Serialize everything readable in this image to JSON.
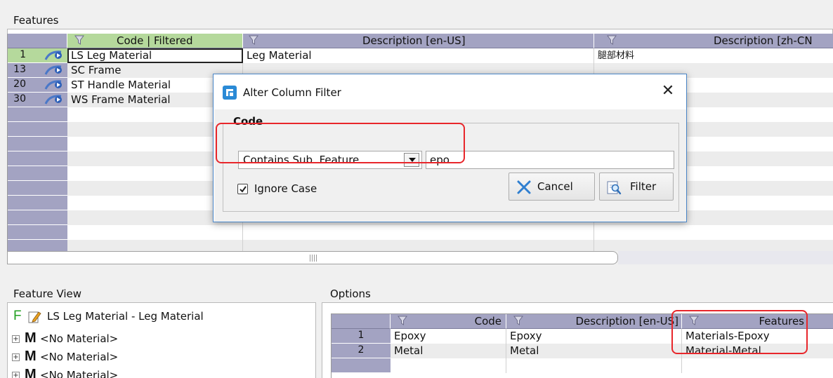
{
  "features_panel": {
    "title": "Features",
    "columns": [
      {
        "label": "Code | Filtered"
      },
      {
        "label": "Description [en-US]"
      },
      {
        "label": "Description [zh-CN"
      }
    ],
    "rows": [
      {
        "num": "1",
        "code": "LS Leg Material",
        "desc": "Leg Material",
        "zh": "腿部材料"
      },
      {
        "num": "13",
        "code": "SC Frame",
        "desc": "",
        "zh": ""
      },
      {
        "num": "20",
        "code": "ST Handle Material",
        "desc": "",
        "zh": ""
      },
      {
        "num": "30",
        "code": "WS Frame Material",
        "desc": "",
        "zh": ""
      }
    ]
  },
  "dialog": {
    "title": "Alter Column Filter",
    "close_glyph": "✕",
    "group_label": "Code",
    "operator": "Contains Sub. Feature",
    "filter_value": "epo",
    "ignore_case_label": "Ignore Case",
    "ignore_case_checked": true,
    "cancel_label": "Cancel",
    "filter_label": "Filter",
    "icons": {
      "app": "app-logo-icon",
      "cancel": "x-cross-icon",
      "filter": "magnifier-filter-icon"
    }
  },
  "feature_view": {
    "title": "Feature View",
    "root": {
      "glyph": "F",
      "label": "LS Leg Material - Leg Material"
    },
    "children": [
      {
        "glyph": "M",
        "label": "<No Material>"
      },
      {
        "glyph": "M",
        "label": "<No Material>"
      },
      {
        "glyph": "M",
        "label": "<No Material>"
      }
    ]
  },
  "options_panel": {
    "title": "Options",
    "columns": [
      {
        "label": "Code"
      },
      {
        "label": "Description [en-US]"
      },
      {
        "label": "Features"
      }
    ],
    "rows": [
      {
        "num": "1",
        "code": "Epoxy",
        "desc": "Epoxy",
        "features": "Materials-Epoxy"
      },
      {
        "num": "2",
        "code": "Metal",
        "desc": "Metal",
        "features": "Material-Metal"
      }
    ]
  },
  "colors": {
    "header": "#a3a3c2",
    "selected_header": "#b5d99c",
    "highlight": "#e8262b",
    "dialog_border": "#4a86c8"
  }
}
